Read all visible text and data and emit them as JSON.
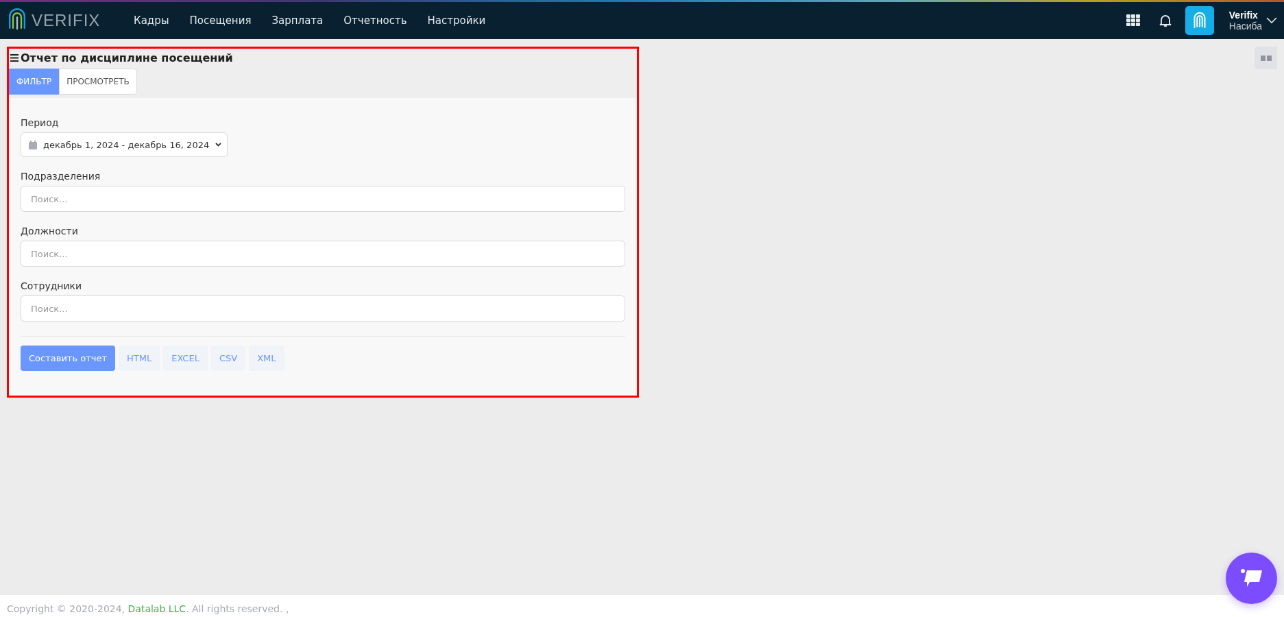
{
  "header": {
    "logo_text": "VERIFIX",
    "nav": [
      {
        "label": "Кадры"
      },
      {
        "label": "Посещения"
      },
      {
        "label": "Зарплата"
      },
      {
        "label": "Отчетность"
      },
      {
        "label": "Настройки"
      }
    ],
    "user": {
      "company": "Verifix",
      "name": "Насиба"
    }
  },
  "report": {
    "title": "Отчет по дисциплине посещений",
    "tabs": [
      {
        "label": "ФИЛЬТР",
        "selected": true
      },
      {
        "label": "ПРОСМОТРЕТЬ",
        "selected": false
      }
    ],
    "period": {
      "label": "Период",
      "value": "декабрь 1, 2024 - декабрь 16, 2024"
    },
    "fields": [
      {
        "label": "Подразделения",
        "placeholder": "Поиск..."
      },
      {
        "label": "Должности",
        "placeholder": "Поиск..."
      },
      {
        "label": "Сотрудники",
        "placeholder": "Поиск..."
      }
    ],
    "buttons": [
      {
        "label": "Составить отчет",
        "kind": "primary"
      },
      {
        "label": "HTML",
        "kind": "secondary"
      },
      {
        "label": "EXCEL",
        "kind": "secondary"
      },
      {
        "label": "CSV",
        "kind": "secondary"
      },
      {
        "label": "XML",
        "kind": "secondary"
      }
    ]
  },
  "footer": {
    "prefix": "Copyright © 2020-2024, ",
    "link": "Datalab LLC",
    "suffix": ". All rights reserved. ,"
  }
}
